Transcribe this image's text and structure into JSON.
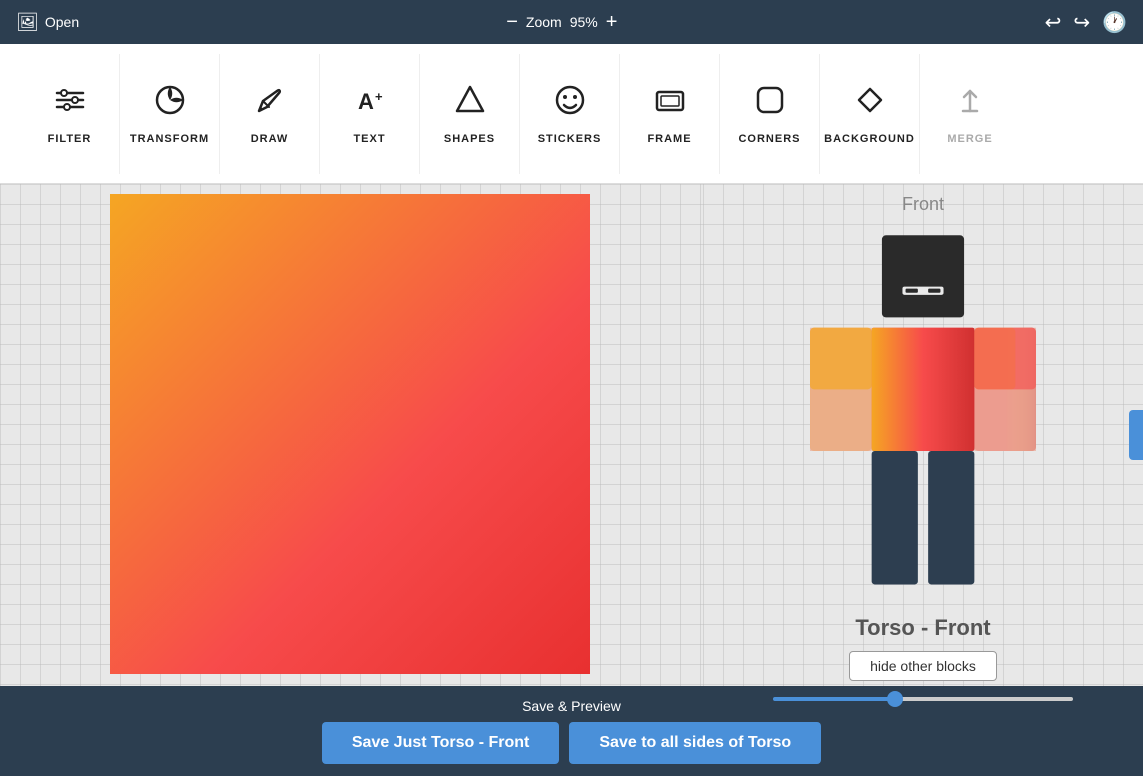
{
  "topbar": {
    "open_label": "Open",
    "zoom_label": "Zoom",
    "zoom_value": "95%",
    "zoom_minus": "−",
    "zoom_plus": "+"
  },
  "toolbar": {
    "items": [
      {
        "id": "filter",
        "label": "FILTER",
        "icon": "⊟",
        "disabled": false
      },
      {
        "id": "transform",
        "label": "TRANSFORM",
        "icon": "↺",
        "disabled": false
      },
      {
        "id": "draw",
        "label": "DRAW",
        "icon": "✏",
        "disabled": false
      },
      {
        "id": "text",
        "label": "TEXT",
        "icon": "A+",
        "disabled": false
      },
      {
        "id": "shapes",
        "label": "SHAPES",
        "icon": "⬠",
        "disabled": false
      },
      {
        "id": "stickers",
        "label": "STICKERS",
        "icon": "☺",
        "disabled": false
      },
      {
        "id": "frame",
        "label": "FRAME",
        "icon": "▭",
        "disabled": false
      },
      {
        "id": "corners",
        "label": "CORNERS",
        "icon": "▢",
        "disabled": false
      },
      {
        "id": "background",
        "label": "BACKGROUND",
        "icon": "◇",
        "disabled": false
      },
      {
        "id": "merge",
        "label": "MERGE",
        "icon": "↑",
        "disabled": true
      }
    ]
  },
  "preview": {
    "view_label": "Front",
    "character_name": "Torso - Front",
    "hide_blocks_label": "hide other blocks",
    "slider_value": 40
  },
  "bottom": {
    "save_preview_label": "Save & Preview",
    "save_front_label": "Save Just Torso - Front",
    "save_all_label": "Save to all sides of Torso"
  },
  "colors": {
    "accent": "#4a90d9",
    "topbar_bg": "#2c3e50",
    "canvas_gradient_start": "#f5a623",
    "canvas_gradient_mid": "#f74b4b",
    "canvas_gradient_end": "#e83030"
  }
}
